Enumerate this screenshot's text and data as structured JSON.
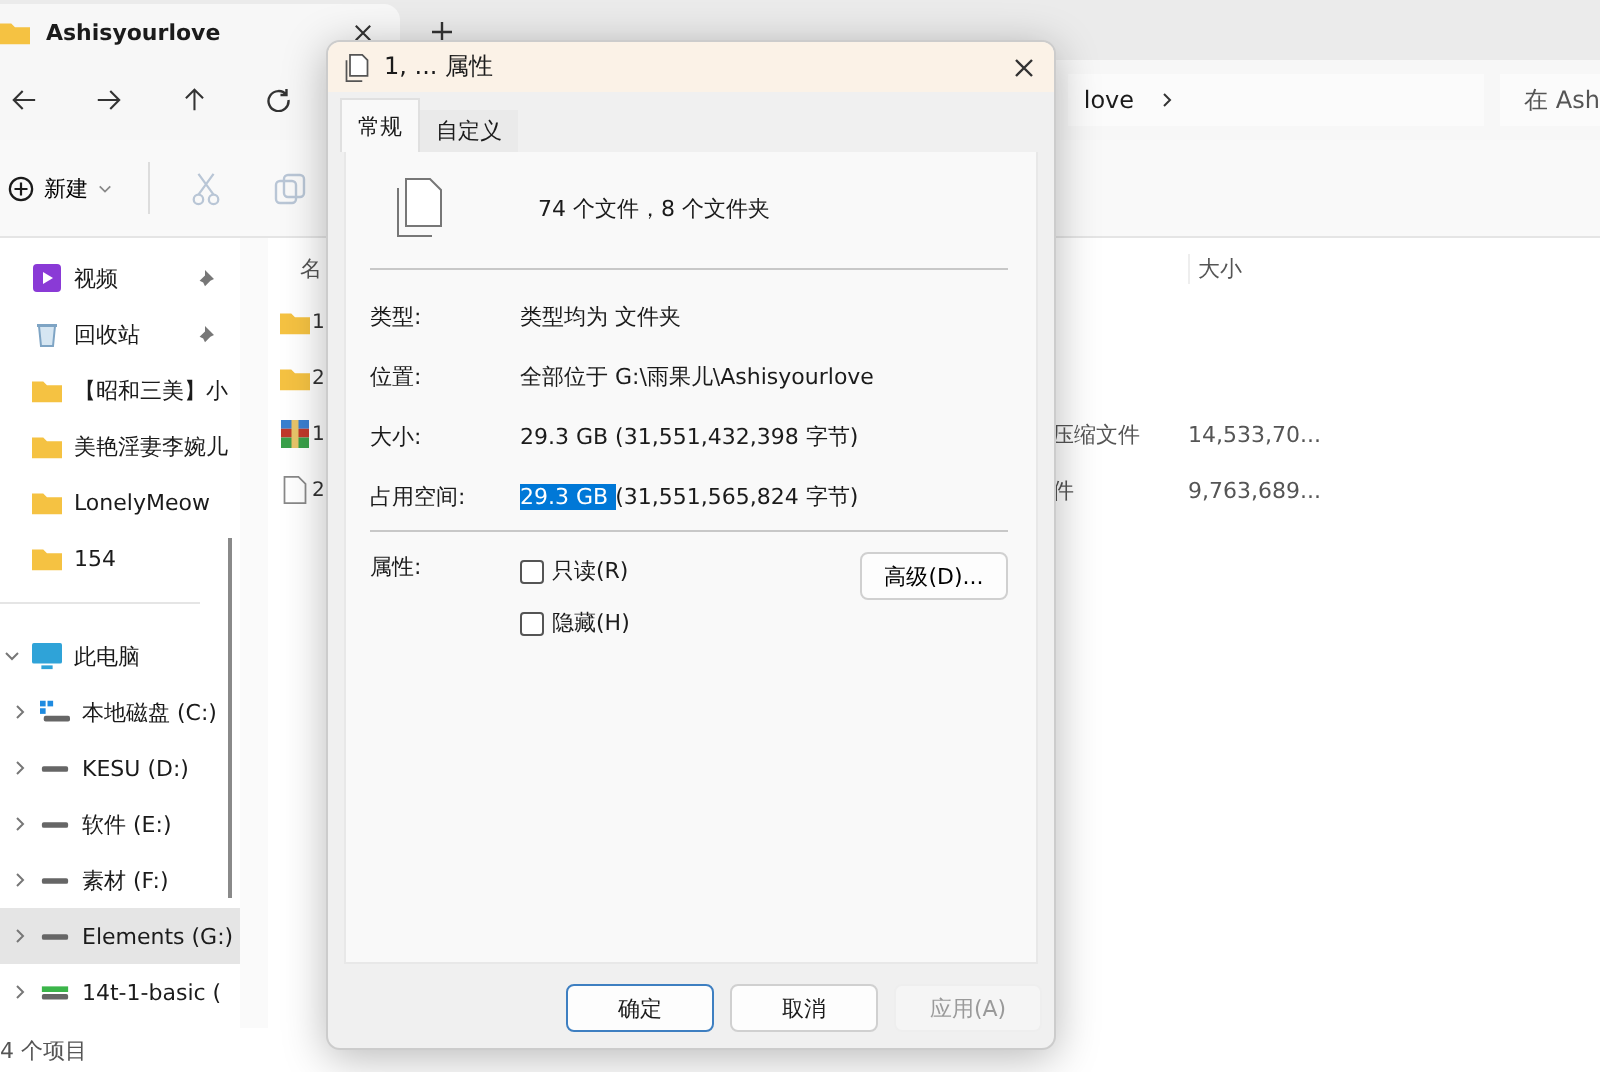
{
  "explorer": {
    "tab_title": "Ashisyourlove",
    "address_tail": "love",
    "search_placeholder": "在 Ash",
    "new_button": "新建",
    "quick_access": [
      {
        "label": "视频",
        "kind": "video",
        "pinned": true,
        "selected": false
      },
      {
        "label": "回收站",
        "kind": "recycle",
        "pinned": true,
        "selected": false
      },
      {
        "label": "【昭和三美】小",
        "kind": "folder",
        "pinned": false,
        "selected": false
      },
      {
        "label": "美艳淫妻李婉儿",
        "kind": "folder",
        "pinned": false,
        "selected": false
      },
      {
        "label": "LonelyMeow",
        "kind": "folder",
        "pinned": false,
        "selected": false
      },
      {
        "label": "154",
        "kind": "folder",
        "pinned": false,
        "selected": false
      }
    ],
    "tree": [
      {
        "label": "此电脑",
        "kind": "pc",
        "expanded": true,
        "selected": false,
        "children": [
          {
            "label": "本地磁盘 (C:)",
            "kind": "os_drive",
            "expanded": false,
            "selected": false
          },
          {
            "label": "KESU (D:)",
            "kind": "drive",
            "expanded": false,
            "selected": false
          },
          {
            "label": "软件 (E:)",
            "kind": "drive",
            "expanded": false,
            "selected": false
          },
          {
            "label": "素材 (F:)",
            "kind": "drive",
            "expanded": false,
            "selected": false
          },
          {
            "label": "Elements (G:)",
            "kind": "drive",
            "expanded": false,
            "selected": true
          },
          {
            "label": "14t-1-basic (",
            "kind": "usb_drive",
            "expanded": false,
            "selected": false
          }
        ]
      }
    ],
    "columns": [
      "名",
      "大小"
    ],
    "files": [
      {
        "name": "1",
        "kind": "folder"
      },
      {
        "name": "2",
        "kind": "folder"
      },
      {
        "name": "1",
        "kind": "archive",
        "type": "压缩文件",
        "size": "14,533,70..."
      },
      {
        "name": "2",
        "kind": "file",
        "type": "件",
        "size": "9,763,689..."
      }
    ],
    "status": "4 个项目"
  },
  "dialog": {
    "title": "1, ... 属性",
    "tabs": [
      {
        "label": "常规",
        "selected": true
      },
      {
        "label": "自定义",
        "selected": false
      }
    ],
    "summary": "74 个文件，8 个文件夹",
    "properties": [
      {
        "label": "类型:",
        "parts": [
          {
            "text": "类型均为 文件夹",
            "selected": false
          }
        ]
      },
      {
        "label": "位置:",
        "parts": [
          {
            "text": "全部位于 G:\\雨果儿\\Ashisyourlove",
            "selected": false
          }
        ]
      },
      {
        "label": "大小:",
        "parts": [
          {
            "text": "29.3 GB (31,551,432,398 字节)",
            "selected": false
          }
        ]
      },
      {
        "label": "占用空间:",
        "parts": [
          {
            "text": "29.3 GB ",
            "selected": true
          },
          {
            "text": "(31,551,565,824 字节)",
            "selected": false
          }
        ]
      }
    ],
    "attributes_label": "属性:",
    "attributes": [
      {
        "label": "只读(R)",
        "checked": false
      },
      {
        "label": "隐藏(H)",
        "checked": false
      }
    ],
    "advanced_button": "高级(D)...",
    "buttons": [
      {
        "label": "确定",
        "kind": "default"
      },
      {
        "label": "取消",
        "kind": "normal"
      },
      {
        "label": "应用(A)",
        "kind": "disabled"
      }
    ]
  }
}
